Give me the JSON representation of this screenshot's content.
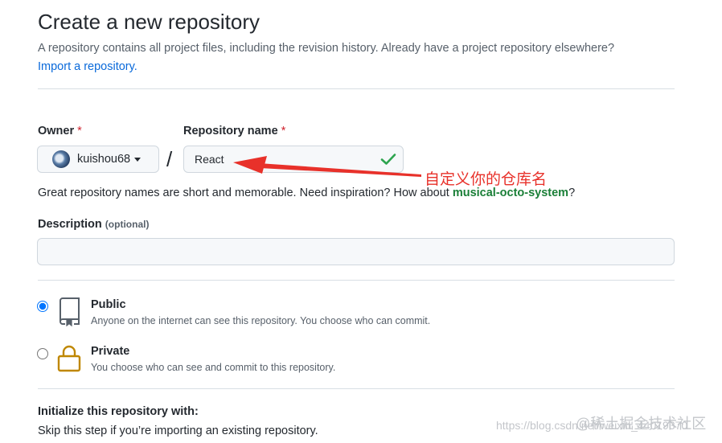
{
  "page": {
    "title": "Create a new repository",
    "subtitle": "A repository contains all project files, including the revision history. Already have a project repository elsewhere?",
    "import_link": "Import a repository."
  },
  "owner": {
    "label": "Owner",
    "required_mark": "*",
    "username": "kuishou68",
    "avatar_icon": "user-avatar",
    "dropdown_icon": "caret-down-icon"
  },
  "separator": "/",
  "repo_name": {
    "label": "Repository name",
    "required_mark": "*",
    "value": "React",
    "status_icon": "check-icon",
    "status_color": "#2da44e"
  },
  "annotation": {
    "text": "自定义你的仓库名",
    "color": "#e8312a"
  },
  "hint": {
    "text": "Great repository names are short and memorable. Need inspiration? How about ",
    "suggestion": "musical-octo-system",
    "suffix": "?"
  },
  "description": {
    "label": "Description",
    "optional_note": "(optional)",
    "value": ""
  },
  "visibility": {
    "selected": "public",
    "options": [
      {
        "id": "public",
        "title": "Public",
        "description": "Anyone on the internet can see this repository. You choose who can commit.",
        "icon": "repo-icon"
      },
      {
        "id": "private",
        "title": "Private",
        "description": "You choose who can see and commit to this repository.",
        "icon": "lock-icon"
      }
    ]
  },
  "initialize": {
    "title": "Initialize this repository with:",
    "description": "Skip this step if you’re importing an existing repository."
  },
  "watermarks": {
    "site": "@稀土掘金技术社区",
    "url": "https://blog.csdn.net/weixin_44019370"
  }
}
